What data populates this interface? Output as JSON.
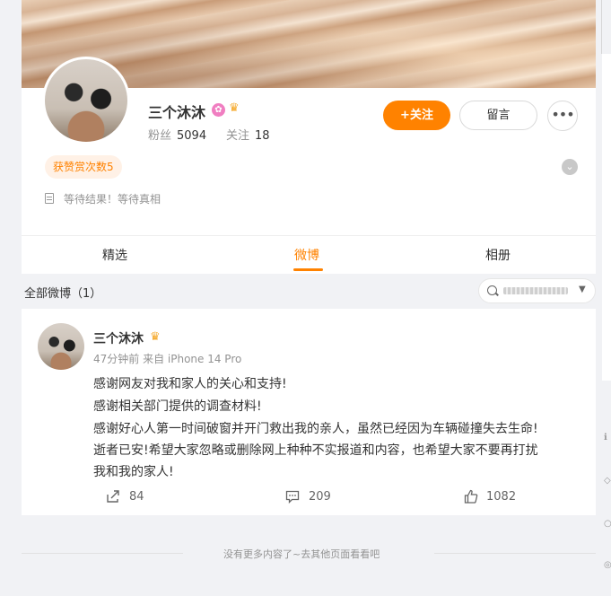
{
  "profile": {
    "name": "三个沐沐",
    "fans_label": "粉丝",
    "fans_count": "5094",
    "follow_label": "关注",
    "follow_count": "18",
    "follow_button": "+关注",
    "message_button": "留言",
    "more_button": "•••",
    "reward_tag": "获赞赏次数5",
    "description": "等待结果！等待真相"
  },
  "tabs": [
    {
      "label": "精选"
    },
    {
      "label": "微博"
    },
    {
      "label": "相册"
    }
  ],
  "feed": {
    "all_label": "全部微博（1）"
  },
  "post": {
    "author": "三个沐沐",
    "meta": "47分钟前 来自 iPhone 14 Pro",
    "lines": [
      "感谢网友对我和家人的关心和支持!",
      "感谢相关部门提供的调查材料!",
      "感谢好心人第一时间破窗并开门救出我的亲人，虽然已经因为车辆碰撞失去生命!",
      "逝者已安!希望大家忽略或删除网上种种不实报道和内容，也希望大家不要再打扰",
      "我和我的家人!"
    ],
    "repost_count": "84",
    "comment_count": "209",
    "like_count": "1082"
  },
  "footer": {
    "end_text": "没有更多内容了~去其他页面看看吧"
  },
  "colors": {
    "accent": "#ff8200",
    "background": "#f1f2f5",
    "muted": "#939393"
  },
  "icons": [
    "search-icon",
    "repost-icon",
    "comment-icon",
    "like-icon",
    "crown-icon",
    "verified-icon",
    "document-icon",
    "chevron-down-icon"
  ]
}
